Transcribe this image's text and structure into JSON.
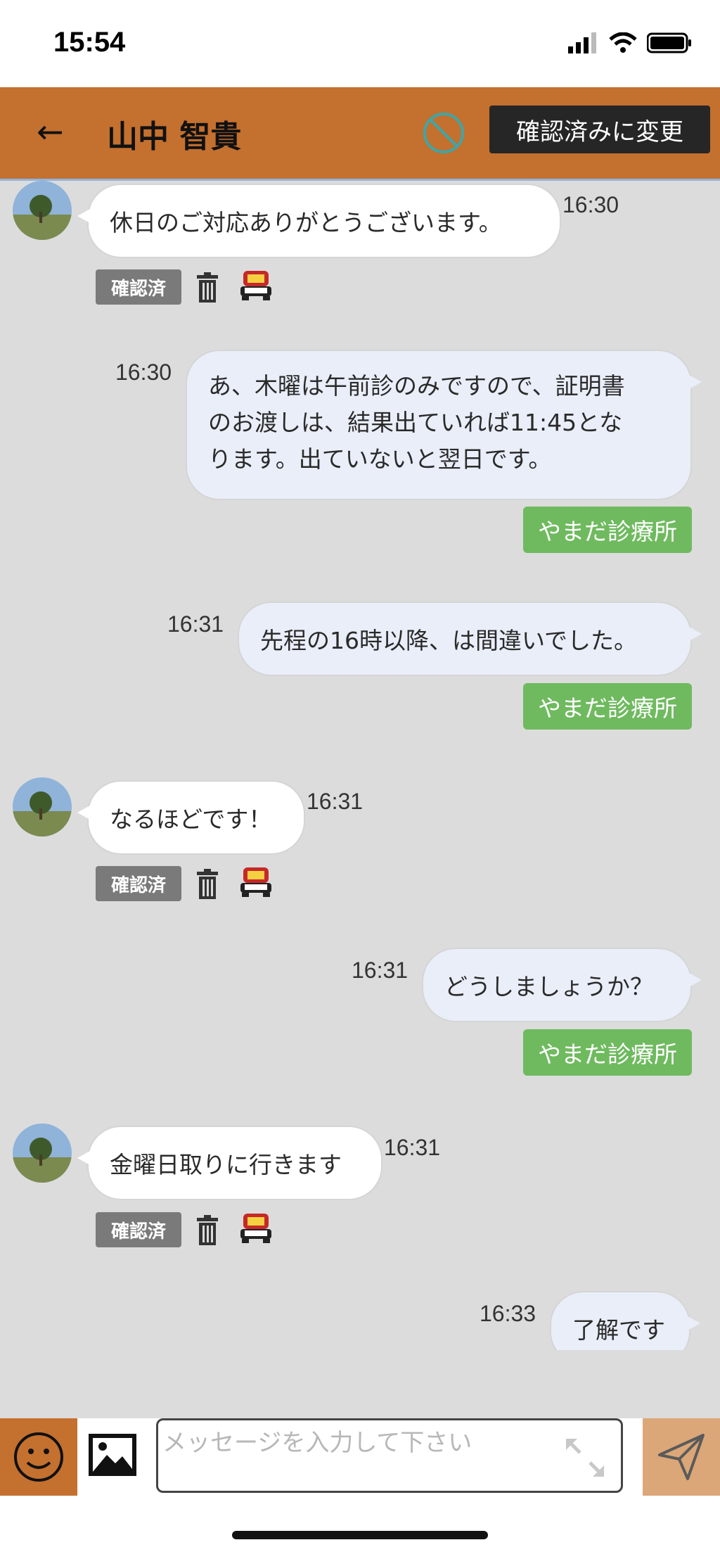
{
  "status": {
    "time": "15:54"
  },
  "header": {
    "back": "←",
    "contact_name": "山中 智貴",
    "confirm_button": "確認済みに変更"
  },
  "messages": {
    "m1": {
      "text": "休日のご対応ありがとうございます。",
      "time": "16:30",
      "badge": "確認済"
    },
    "m2": {
      "lines": [
        "あ、木曜は午前診のみですので、証明書",
        "のお渡しは、結果出ていれば11:45とな",
        "ります。出ていないと翌日です。"
      ],
      "time": "16:30",
      "sender": "やまだ診療所"
    },
    "m3": {
      "text": "先程の16時以降、は間違いでした。",
      "time": "16:31",
      "sender": "やまだ診療所"
    },
    "m4": {
      "text": "なるほどです！",
      "time": "16:31",
      "badge": "確認済"
    },
    "m5": {
      "text": "どうしましょうか？",
      "time": "16:31",
      "sender": "やまだ診療所"
    },
    "m6": {
      "text": "金曜日取りに行きます",
      "time": "16:31",
      "badge": "確認済"
    },
    "m7": {
      "text": "了解です",
      "time": "16:33"
    }
  },
  "input": {
    "placeholder": "メッセージを入力して下さい"
  },
  "colors": {
    "header": "#c4702f",
    "sender_badge": "#6fba5f",
    "outgoing_bubble": "#e9eef9",
    "chat_bg": "#dcdcdc"
  }
}
